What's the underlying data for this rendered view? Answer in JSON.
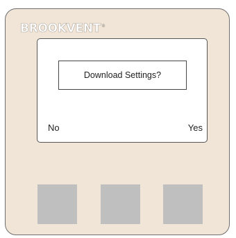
{
  "device": {
    "brand": "BROOKVENT",
    "trademark": "®"
  },
  "screen": {
    "dialog_text": "Download Settings?",
    "left_softkey_label": "No",
    "right_softkey_label": "Yes"
  },
  "buttons": [
    {
      "name": "left-button",
      "color": "#bfbfbf"
    },
    {
      "name": "middle-button",
      "color": "#bfbfbf"
    },
    {
      "name": "right-button",
      "color": "#bfbfbf"
    }
  ],
  "colors": {
    "panel": "#f0e5d6",
    "screen": "#ffffff",
    "button": "#bfbfbf"
  }
}
